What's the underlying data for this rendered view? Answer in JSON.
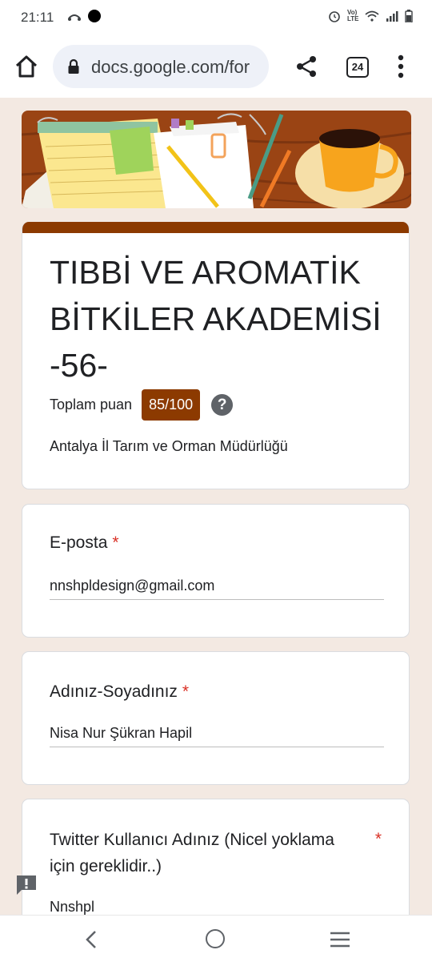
{
  "status": {
    "time": "21:11",
    "network": "Vo) LTE"
  },
  "browser": {
    "url": "docs.google.com/for",
    "tab_count": "24"
  },
  "form": {
    "title": "TIBBİ VE AROMATİK BİTKİLER AKADEMİSİ -56-",
    "score_label": "Toplam puan",
    "score_value": "85/100",
    "help_symbol": "?",
    "description": "Antalya İl Tarım ve Orman Müdürlüğü"
  },
  "questions": [
    {
      "title": "E-posta",
      "required": "*",
      "answer": "nnshpldesign@gmail.com"
    },
    {
      "title": "Adınız-Soyadınız",
      "required": "*",
      "answer": "Nisa Nur Şükran Hapil"
    },
    {
      "title": "Twitter Kullanıcı Adınız (Nicel yoklama için gereklidir..)",
      "required": "*",
      "answer": "Nnshpl"
    }
  ],
  "icons": {
    "home": "home-icon",
    "lock": "lock-icon",
    "share": "share-icon",
    "menu": "more-vert-icon",
    "report": "report-icon",
    "back": "back-icon",
    "nav_home": "nav-home-icon",
    "recents": "recents-icon"
  },
  "colors": {
    "theme": "#8c3a00",
    "background": "#f3e9e2",
    "required": "#d93025"
  }
}
